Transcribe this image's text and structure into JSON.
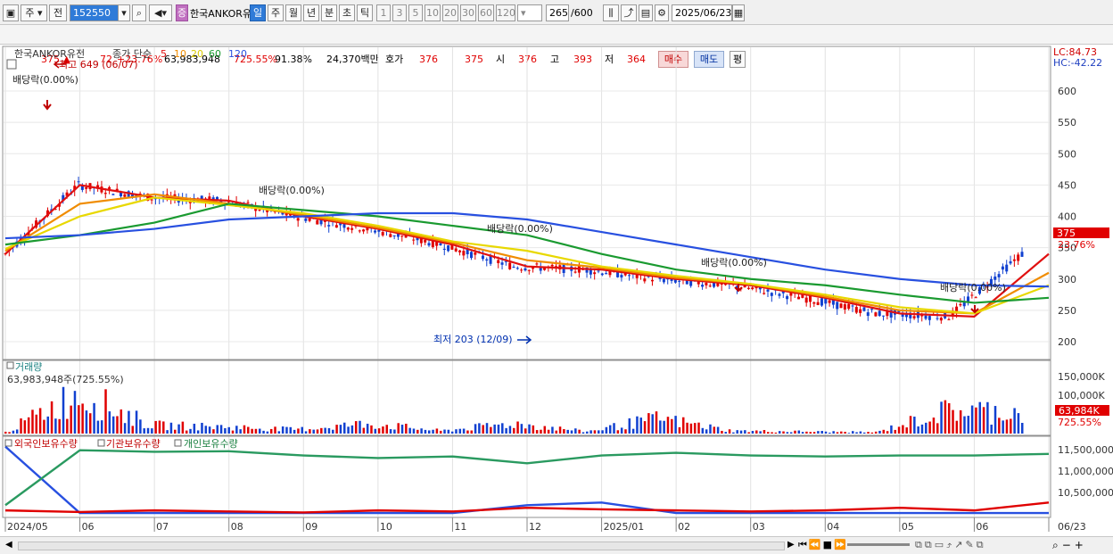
{
  "toolbar": {
    "period_unit": "주",
    "prev": "전",
    "code": "152550",
    "type_badge": "증",
    "name": "한국ANKOR유",
    "period_tabs": [
      "일",
      "주",
      "월",
      "년",
      "분",
      "초",
      "틱"
    ],
    "active_tab": "일",
    "intervals": [
      "1",
      "3",
      "5",
      "10",
      "20",
      "30",
      "60",
      "120"
    ],
    "count": "265",
    "count_max": "/600",
    "date": "2025/06/23"
  },
  "quote": {
    "price": "375 ▲",
    "change": "72",
    "change_pct": "+23.76%",
    "volume": "63,983,948",
    "volume_pct": "725.55%",
    "turnover_pct": "91.38%",
    "amount": "24,370백만",
    "hoga_label": "호가",
    "hoga1": "376",
    "hoga2": "375",
    "open_label": "시",
    "open": "376",
    "high_label": "고",
    "high": "393",
    "low_label": "저",
    "low": "364",
    "buy": "매수",
    "sell": "매도",
    "avg": "평"
  },
  "legend": {
    "name": "한국ANKOR유전",
    "close_label": "종가 단순",
    "ma": [
      {
        "label": "5",
        "color": "#e01010"
      },
      {
        "label": "10",
        "color": "#f08c00"
      },
      {
        "label": "20",
        "color": "#e8d800"
      },
      {
        "label": "60",
        "color": "#1a9a30"
      },
      {
        "label": "120",
        "color": "#2850e0"
      }
    ],
    "lc": "LC:84.73",
    "hc": "HC:-42.22"
  },
  "annotations": {
    "high": "최고 649 (06/07)",
    "low": "최저 203 (12/09)",
    "dividend": "배당락(0.00%)"
  },
  "price_axis": {
    "ticks": [
      "600",
      "550",
      "500",
      "450",
      "400",
      "350",
      "300",
      "250",
      "200"
    ],
    "current": "375",
    "current_pct": "23.76%"
  },
  "volume_panel": {
    "title": "거래량",
    "value": "63,983,948주(725.55%)",
    "ticks": [
      "150,000K",
      "100,000K",
      "50,000K"
    ],
    "current": "63,984K",
    "current_pct": "725.55%"
  },
  "holdings_panel": {
    "labels": [
      "외국인보유수량",
      "기관보유수량",
      "개인보유수량"
    ],
    "ticks": [
      "11,500,000",
      "11,000,000",
      "10,500,000"
    ]
  },
  "x_axis": {
    "labels": [
      "2024/05",
      "06",
      "07",
      "08",
      "09",
      "10",
      "11",
      "12",
      "2025/01",
      "02",
      "03",
      "04",
      "05",
      "06",
      "06/23"
    ]
  },
  "chart_data": [
    {
      "type": "candlestick",
      "title": "한국ANKOR유전",
      "ylim": [
        180,
        640
      ],
      "x": [
        "2024/05",
        "06",
        "07",
        "08",
        "09",
        "10",
        "11",
        "12",
        "2025/01",
        "02",
        "03",
        "04",
        "05",
        "06",
        "06/23"
      ],
      "series": [
        {
          "name": "5",
          "values": [
            340,
            450,
            430,
            425,
            400,
            380,
            355,
            320,
            315,
            300,
            290,
            270,
            245,
            240,
            340
          ]
        },
        {
          "name": "10",
          "values": [
            345,
            420,
            435,
            420,
            402,
            382,
            358,
            330,
            318,
            302,
            292,
            272,
            250,
            245,
            310
          ]
        },
        {
          "name": "20",
          "values": [
            348,
            400,
            430,
            418,
            405,
            385,
            360,
            345,
            320,
            305,
            292,
            275,
            255,
            245,
            290
          ]
        },
        {
          "name": "60",
          "values": [
            355,
            370,
            390,
            420,
            410,
            400,
            385,
            370,
            340,
            315,
            300,
            290,
            275,
            262,
            270
          ]
        },
        {
          "name": "120",
          "values": [
            365,
            370,
            380,
            395,
            400,
            405,
            405,
            395,
            375,
            355,
            335,
            315,
            300,
            290,
            288
          ]
        }
      ],
      "current": 375,
      "high": 649,
      "low": 203
    },
    {
      "type": "bar",
      "title": "거래량",
      "ylim": [
        0,
        160000
      ],
      "x": [
        "2024/05",
        "06",
        "07",
        "08",
        "09",
        "10",
        "11",
        "12",
        "2025/01",
        "02",
        "03",
        "04",
        "05",
        "06",
        "06/23"
      ],
      "values": [
        4000,
        120000,
        25000,
        20000,
        12000,
        30000,
        8000,
        30000,
        6000,
        45000,
        8000,
        6000,
        4000,
        70000,
        63984
      ]
    },
    {
      "type": "line",
      "title": "외국인보유수량 기관보유수량 개인보유수량",
      "ylim": [
        10200000,
        11700000
      ],
      "x": [
        "2024/05",
        "06",
        "07",
        "08",
        "09",
        "10",
        "11",
        "12",
        "2025/01",
        "02",
        "03",
        "04",
        "05",
        "06",
        "06/23"
      ],
      "series": [
        {
          "name": "외국인보유수량",
          "values": [
            11520000,
            10250000,
            10250000,
            10250000,
            10250000,
            10250000,
            10250000,
            10400000,
            10450000,
            10250000,
            10250000,
            10250000,
            10250000,
            10250000,
            10250000
          ]
        },
        {
          "name": "기관보유수량",
          "values": [
            10300000,
            10270000,
            10300000,
            10280000,
            10260000,
            10300000,
            10280000,
            10350000,
            10320000,
            10300000,
            10280000,
            10300000,
            10350000,
            10300000,
            10450000
          ]
        },
        {
          "name": "개인보유수량",
          "values": [
            10400000,
            11450000,
            11420000,
            11430000,
            11350000,
            11300000,
            11330000,
            11200000,
            11350000,
            11400000,
            11350000,
            11330000,
            11350000,
            11350000,
            11380000
          ]
        }
      ]
    }
  ]
}
